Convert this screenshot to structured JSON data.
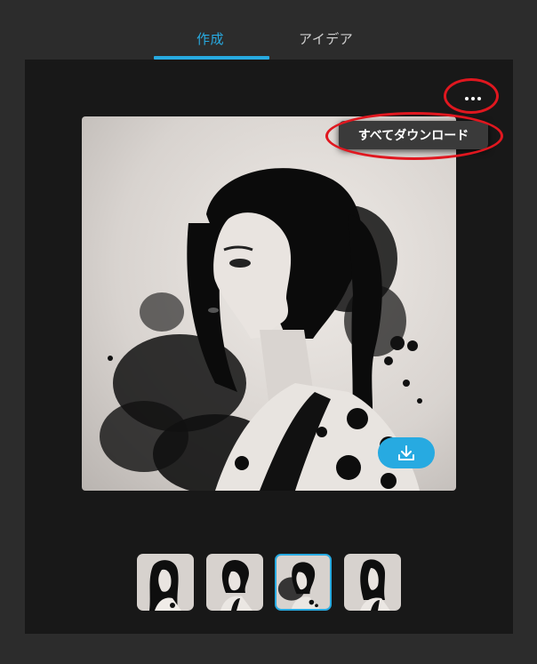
{
  "tabs": [
    {
      "label": "作成",
      "active": true
    },
    {
      "label": "アイデア",
      "active": false
    }
  ],
  "more_menu": {
    "icon": "ellipsis-icon",
    "item_label": "すべてダウンロード"
  },
  "preview": {
    "download_icon": "download-icon",
    "subject": "ink-wash portrait of woman in kimono, profile view"
  },
  "thumbnails": [
    {
      "selected": false
    },
    {
      "selected": false
    },
    {
      "selected": true
    },
    {
      "selected": false
    }
  ],
  "colors": {
    "accent": "#27aae1",
    "annotation_red": "#e0171f",
    "page_bg": "#2c2c2c",
    "panel_bg": "#181818"
  }
}
